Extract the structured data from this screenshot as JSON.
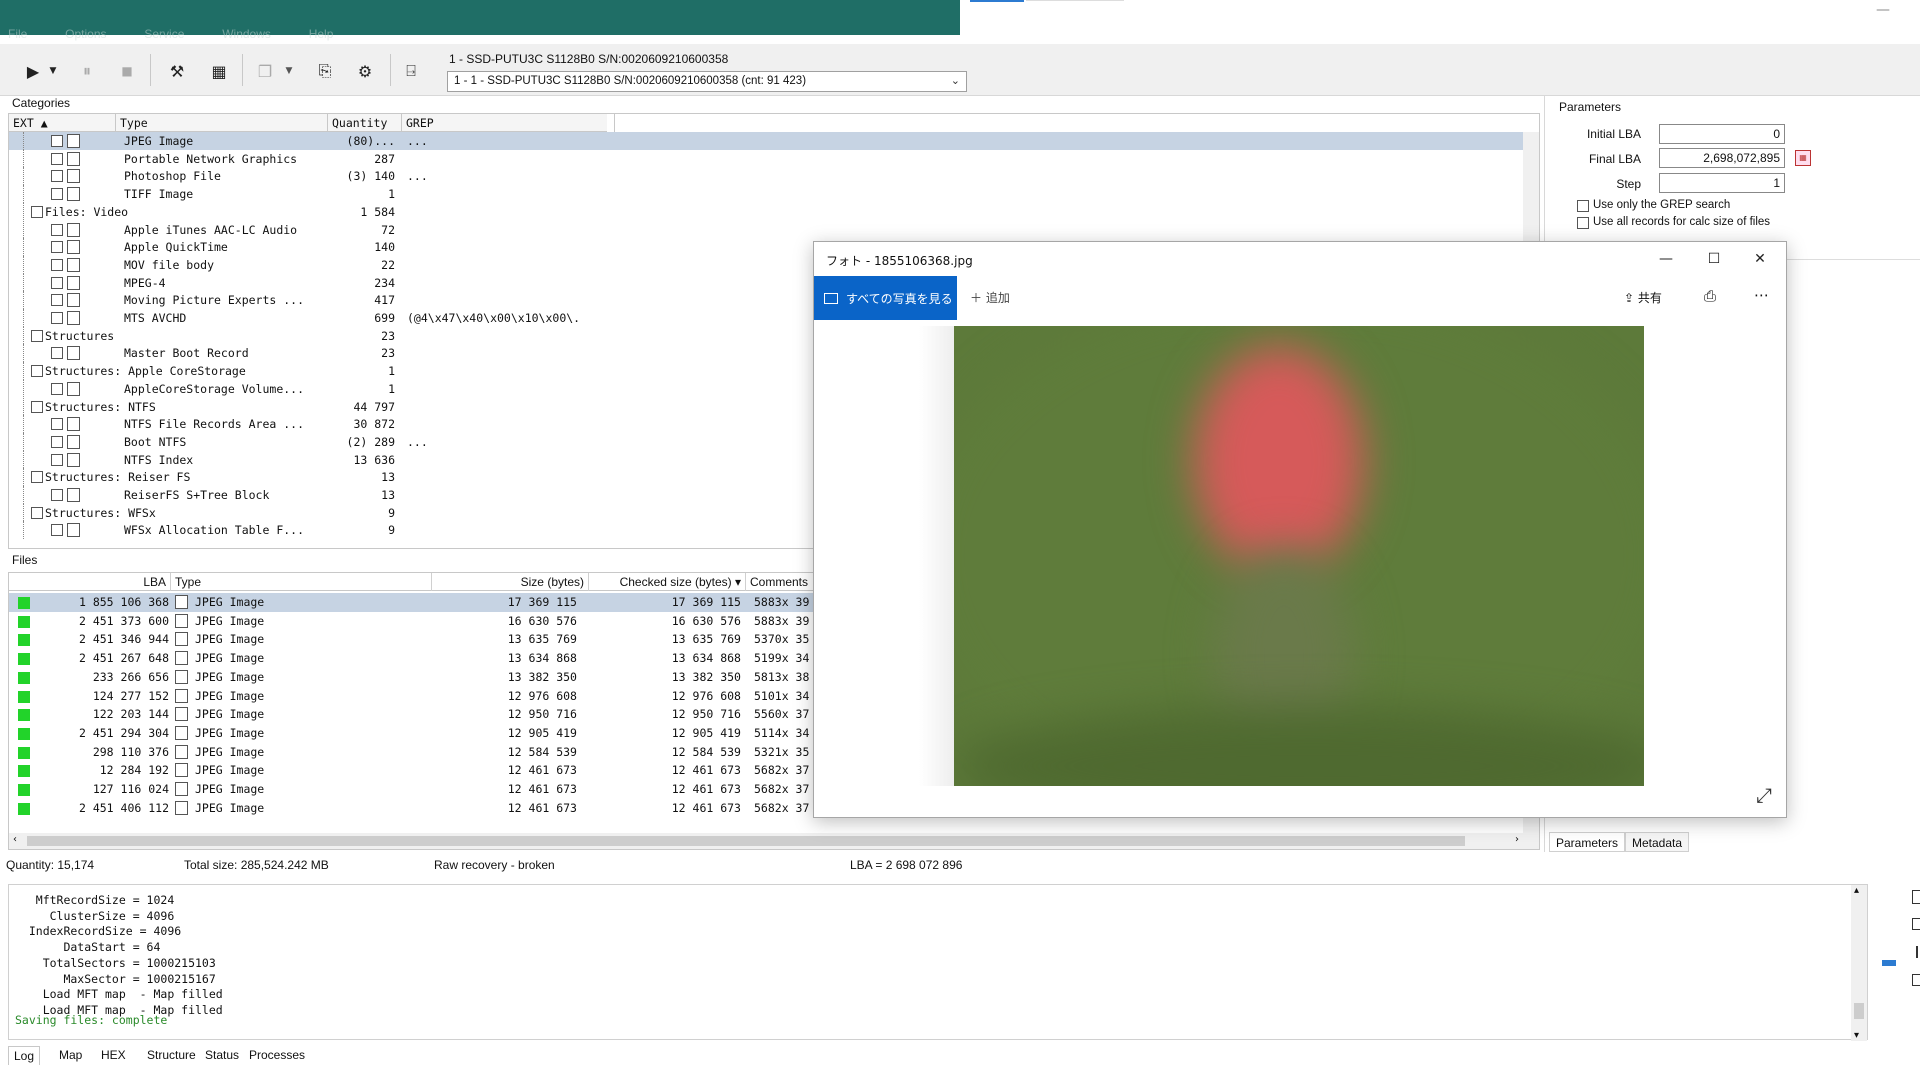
{
  "app": {
    "menu": [
      "File",
      "Options",
      "Service",
      "Windows",
      "Help"
    ]
  },
  "toolbar": {
    "device_label": "1 - SSD-PUTU3C S1128B0 S/N:0020609210600358",
    "device_select": "1 - 1 - SSD-PUTU3C S1128B0 S/N:0020609210600358 (cnt: 91 423)"
  },
  "categories": {
    "title": "Categories",
    "headers": {
      "ext": "EXT",
      "type": "Type",
      "quantity": "Quantity",
      "grep": "GREP"
    },
    "rows": [
      {
        "level": 2,
        "name": "JPEG Image",
        "qty": "(80)...",
        "grep": "...",
        "selected": true,
        "icon": "image-icon"
      },
      {
        "level": 2,
        "name": "Portable Network Graphics",
        "qty": "287",
        "grep": "",
        "icon": "image-icon"
      },
      {
        "level": 2,
        "name": "Photoshop File",
        "qty": "(3) 140",
        "grep": "...",
        "icon": "psd-icon"
      },
      {
        "level": 2,
        "name": "TIFF Image",
        "qty": "1",
        "grep": "",
        "icon": "image-icon"
      },
      {
        "level": 1,
        "name": "Files: Video",
        "qty": "1 584",
        "grep": ""
      },
      {
        "level": 2,
        "name": "Apple iTunes AAC-LC Audio",
        "qty": "72",
        "grep": "",
        "icon": "audio-icon"
      },
      {
        "level": 2,
        "name": "Apple QuickTime",
        "qty": "140",
        "grep": "",
        "icon": "vlc-icon"
      },
      {
        "level": 2,
        "name": "MOV file body",
        "qty": "22",
        "grep": "",
        "icon": "file-icon"
      },
      {
        "level": 2,
        "name": "MPEG-4",
        "qty": "234",
        "grep": "",
        "icon": "video-icon"
      },
      {
        "level": 2,
        "name": "Moving Picture Experts ...",
        "qty": "417",
        "grep": "",
        "icon": "video-icon"
      },
      {
        "level": 2,
        "name": "MTS AVCHD",
        "qty": "699",
        "grep": "(@4\\x47\\x40\\x00\\x10\\x00\\.",
        "icon": "vlc-icon"
      },
      {
        "level": 1,
        "name": "Structures",
        "qty": "23",
        "grep": ""
      },
      {
        "level": 2,
        "name": "Master Boot Record",
        "qty": "23",
        "grep": "",
        "icon": "file-icon"
      },
      {
        "level": 1,
        "name": "Structures: Apple CoreStorage",
        "qty": "1",
        "grep": ""
      },
      {
        "level": 2,
        "name": "AppleCoreStorage Volume...",
        "qty": "1",
        "grep": "",
        "icon": "file-icon"
      },
      {
        "level": 1,
        "name": "Structures: NTFS",
        "qty": "44 797",
        "grep": ""
      },
      {
        "level": 2,
        "name": "NTFS File Records Area ...",
        "qty": "30 872",
        "grep": "",
        "icon": "file-icon"
      },
      {
        "level": 2,
        "name": "Boot NTFS",
        "qty": "(2) 289",
        "grep": "...",
        "icon": "file-icon"
      },
      {
        "level": 2,
        "name": "NTFS Index",
        "qty": "13 636",
        "grep": "",
        "icon": "file-icon"
      },
      {
        "level": 1,
        "name": "Structures: Reiser FS",
        "qty": "13",
        "grep": ""
      },
      {
        "level": 2,
        "name": "ReiserFS S+Tree Block",
        "qty": "13",
        "grep": "",
        "icon": "file-icon"
      },
      {
        "level": 1,
        "name": "Structures: WFSx",
        "qty": "9",
        "grep": ""
      },
      {
        "level": 2,
        "name": "WFSx Allocation Table F...",
        "qty": "9",
        "grep": "",
        "icon": "file-icon"
      }
    ]
  },
  "files": {
    "title": "Files",
    "headers": {
      "lba": "LBA",
      "type": "Type",
      "size": "Size (bytes)",
      "checked": "Checked size (bytes)",
      "comments": "Comments"
    },
    "rows": [
      {
        "lba": "1 855 106 368",
        "type": "JPEG Image",
        "size": "17 369 115",
        "checked": "17 369 115",
        "comment": "5883x 39",
        "selected": true
      },
      {
        "lba": "2 451 373 600",
        "type": "JPEG Image",
        "size": "16 630 576",
        "checked": "16 630 576",
        "comment": "5883x 39"
      },
      {
        "lba": "2 451 346 944",
        "type": "JPEG Image",
        "size": "13 635 769",
        "checked": "13 635 769",
        "comment": "5370x 35"
      },
      {
        "lba": "2 451 267 648",
        "type": "JPEG Image",
        "size": "13 634 868",
        "checked": "13 634 868",
        "comment": "5199x 34"
      },
      {
        "lba": "233 266 656",
        "type": "JPEG Image",
        "size": "13 382 350",
        "checked": "13 382 350",
        "comment": "5813x 38"
      },
      {
        "lba": "124 277 152",
        "type": "JPEG Image",
        "size": "12 976 608",
        "checked": "12 976 608",
        "comment": "5101x 34"
      },
      {
        "lba": "122 203 144",
        "type": "JPEG Image",
        "size": "12 950 716",
        "checked": "12 950 716",
        "comment": "5560x 37"
      },
      {
        "lba": "2 451 294 304",
        "type": "JPEG Image",
        "size": "12 905 419",
        "checked": "12 905 419",
        "comment": "5114x 34"
      },
      {
        "lba": "298 110 376",
        "type": "JPEG Image",
        "size": "12 584 539",
        "checked": "12 584 539",
        "comment": "5321x 35"
      },
      {
        "lba": "12 284 192",
        "type": "JPEG Image",
        "size": "12 461 673",
        "checked": "12 461 673",
        "comment": "5682x 37"
      },
      {
        "lba": "127 116 024",
        "type": "JPEG Image",
        "size": "12 461 673",
        "checked": "12 461 673",
        "comment": "5682x 37"
      },
      {
        "lba": "2 451 406 112",
        "type": "JPEG Image",
        "size": "12 461 673",
        "checked": "12 461 673",
        "comment": "5682x 37"
      }
    ]
  },
  "status": {
    "quantity": "Quantity: 15,174",
    "total": "Total size: 285,524.242 MB",
    "mode": "Raw recovery - broken",
    "lba": "LBA =  2 698 072 896"
  },
  "parameters": {
    "title": "Parameters",
    "initial_label": "Initial LBA",
    "initial_value": "0",
    "final_label": "Final LBA",
    "final_value": "2,698,072,895",
    "step_label": "Step",
    "step_value": "1",
    "opt1": "Use only the GREP search",
    "opt2": "Use all records for calc size of files",
    "tab_params": "Parameters",
    "tab_meta": "Metadata"
  },
  "log": {
    "lines": [
      "   MftRecordSize = 1024",
      "     ClusterSize = 4096",
      "  IndexRecordSize = 4096",
      "       DataStart = 64",
      "    TotalSectors = 1000215103",
      "       MaxSector = 1000215167",
      "    Load MFT map  - Map filled",
      "    Load MFT map  - Map filled"
    ],
    "final_line": "Saving files: complete",
    "tabs": [
      "Log",
      "Map",
      "HEX",
      "Structure",
      "Status",
      "Processes"
    ]
  },
  "photo": {
    "title": "フォト - 1855106368.jpg",
    "all_photos": "すべての写真を見る",
    "add": "＋ 追加",
    "share": "共有",
    "colors": {
      "accent": "#0a64c8",
      "grass": "#5d7a3a",
      "red": "#d65a5a"
    }
  }
}
